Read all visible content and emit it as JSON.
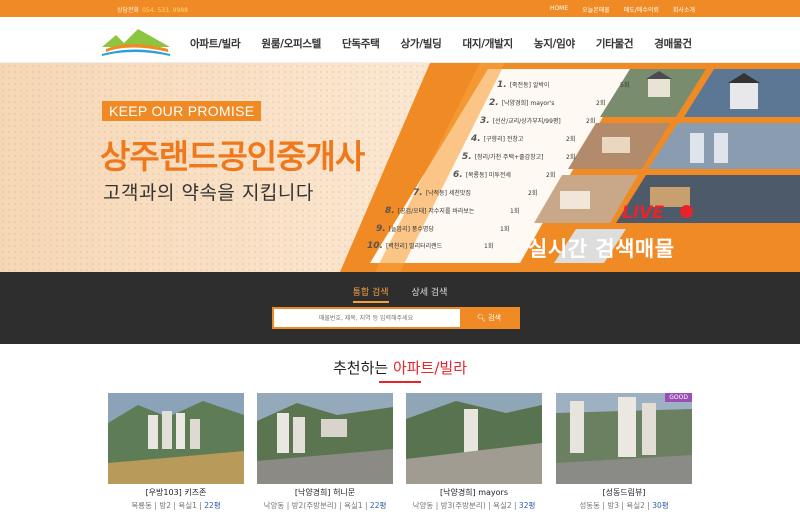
{
  "topbar": {
    "consult_label": "상담전화",
    "consult_number": "054. 533. 9988",
    "links": [
      "HOME",
      "오늘본매물",
      "매도/매수의뢰",
      "회사소개"
    ]
  },
  "nav": [
    "아파트/빌라",
    "원룸/오피스텔",
    "단독주택",
    "상가/빌딩",
    "대지/개발지",
    "농지/임야",
    "기타물건",
    "경매물건"
  ],
  "hero": {
    "promise": "KEEP OUR PROMISE",
    "company": "상주랜드공인중개사",
    "tagline": "고객과의 약속을 지킵니다",
    "live": "LIVE",
    "realtime": "실시간 검색매물",
    "ranking": [
      {
        "n": "1.",
        "label": "[죽전동] 알박이",
        "count": "5회"
      },
      {
        "n": "2.",
        "label": "[낙양경희] mayor's",
        "count": "2회"
      },
      {
        "n": "3.",
        "label": "[선산/교리/상가부지/99평]",
        "count": "2회"
      },
      {
        "n": "4.",
        "label": "[구향리] 전창고",
        "count": "2회"
      },
      {
        "n": "5.",
        "label": "[청리/가천 주택+줄감창고]",
        "count": "2회"
      },
      {
        "n": "6.",
        "label": "[복룡동] 미투전세",
        "count": "2회"
      },
      {
        "n": "7.",
        "label": "[낙적동] 세천맛집",
        "count": "2회"
      },
      {
        "n": "8.",
        "label": "[공검/오태] 저수지를 바라보는",
        "count": "1회"
      },
      {
        "n": "9.",
        "label": "[늘암리] 풍수명당",
        "count": "1회"
      },
      {
        "n": "10.",
        "label": "[벽천리] 밀리터리랜드",
        "count": "1회"
      }
    ]
  },
  "search": {
    "tabs": [
      "통합 검색",
      "상세 검색"
    ],
    "placeholder": "매물번호, 제목, 지역 등 입력해주세요",
    "button": "검색"
  },
  "recommend": {
    "title_prefix": "추천하는 ",
    "title_highlight": "아파트/빌라",
    "cards": [
      {
        "name": "[우방103] 키즈존",
        "loc": "복룡동",
        "rooms": "방2",
        "baths": "욕실1",
        "size": "22평",
        "badge": ""
      },
      {
        "name": "[낙양경희] 허니문",
        "loc": "낙양동",
        "rooms": "방2(주방분리)",
        "baths": "욕실1",
        "size": "22평",
        "badge": ""
      },
      {
        "name": "[낙양경희] mayors",
        "loc": "낙양동",
        "rooms": "방3(주방분리)",
        "baths": "욕실2",
        "size": "32평",
        "badge": ""
      },
      {
        "name": "[성동드림뷰]",
        "loc": "성동동",
        "rooms": "방3",
        "baths": "욕실2",
        "size": "30평",
        "badge": "GOOD"
      }
    ]
  },
  "colors": {
    "accent": "#f08a24",
    "dark": "#2e2e2e",
    "red": "#e8232a"
  }
}
